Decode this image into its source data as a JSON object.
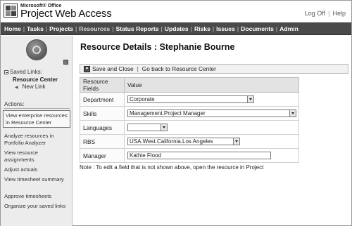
{
  "header": {
    "brand_small": "Microsoft® Office",
    "brand_title": "Project Web Access",
    "links": [
      "Log Off",
      "Help"
    ]
  },
  "nav": {
    "tabs": [
      "Home",
      "Tasks",
      "Projects",
      "Resources",
      "Status Reports",
      "Updates",
      "Risks",
      "Issues",
      "Documents",
      "Admin"
    ],
    "active_tab": "Resources"
  },
  "sidebar": {
    "saved_links_label": "Saved Links:",
    "current_item": "Resource Center",
    "new_link": "New Link",
    "actions_label": "Actions:",
    "actions": [
      "View enterprise resources in Resource Center",
      "Analyze resources in Portfolio Analyzer",
      "View resource assignments",
      "Adjust actuals",
      "View timesheet summary",
      "Approve timesheets",
      "Organize your saved links"
    ]
  },
  "main": {
    "title": "Resource Details : Stephanie Bourne",
    "toolbar": {
      "save_close": "Save and Close",
      "go_back": "Go back to Resource Center"
    },
    "table": {
      "columns": [
        "Resource Fields",
        "Value"
      ],
      "rows": [
        {
          "label": "Department",
          "value": "Corporate",
          "kind": "select"
        },
        {
          "label": "Skills",
          "value": "Management.Project Manager",
          "kind": "select"
        },
        {
          "label": "Languages",
          "value": "",
          "kind": "select"
        },
        {
          "label": "RBS",
          "value": "USA.West.California.Los Angeles",
          "kind": "select"
        },
        {
          "label": "Manager",
          "value": "Kathie Flood",
          "kind": "text"
        }
      ]
    },
    "note": "Note : To edit a field that is not shown above, open the resource in Project"
  }
}
